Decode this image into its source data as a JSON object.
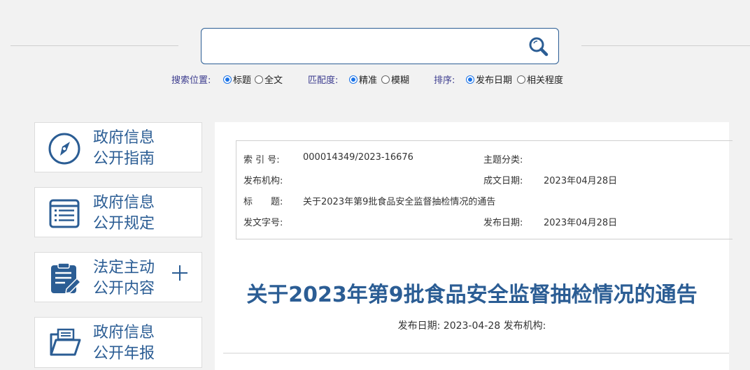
{
  "search": {
    "value": "",
    "button_icon": "search-icon"
  },
  "options": {
    "position": {
      "label": "搜索位置:",
      "choices": [
        "标题",
        "全文"
      ],
      "selected": "标题"
    },
    "match": {
      "label": "匹配度:",
      "choices": [
        "精准",
        "模糊"
      ],
      "selected": "精准"
    },
    "sort": {
      "label": "排序:",
      "choices": [
        "发布日期",
        "相关程度"
      ],
      "selected": "发布日期"
    }
  },
  "sidebar": {
    "items": [
      {
        "line1": "政府信息",
        "line2": "公开指南",
        "icon": "compass-icon"
      },
      {
        "line1": "政府信息",
        "line2": "公开规定",
        "icon": "list-document-icon"
      },
      {
        "line1": "法定主动",
        "line2": "公开内容",
        "icon": "clipboard-edit-icon",
        "expand_icon": "plus-icon"
      },
      {
        "line1": "政府信息",
        "line2": "公开年报",
        "icon": "folder-icon"
      }
    ]
  },
  "meta": {
    "index_label": "索 引 号:",
    "index_value": "000014349/2023-16676",
    "topic_label": "主题分类:",
    "topic_value": "",
    "org_label": "发布机构:",
    "org_value": "",
    "created_label": "成文日期:",
    "created_value": "2023年04月28日",
    "title_label": "标　　题:",
    "title_value": "关于2023年第9批食品安全监督抽检情况的通告",
    "docno_label": "发文字号:",
    "docno_value": "",
    "published_label": "发布日期:",
    "published_value": "2023年04月28日"
  },
  "article": {
    "title": "关于2023年第9批食品安全监督抽检情况的通告",
    "subline": "发布日期: 2023-04-28 发布机构:"
  },
  "colors": {
    "brand": "#2b5d94",
    "radio_accent": "#1a73e8",
    "background": "#f2f2f2"
  }
}
